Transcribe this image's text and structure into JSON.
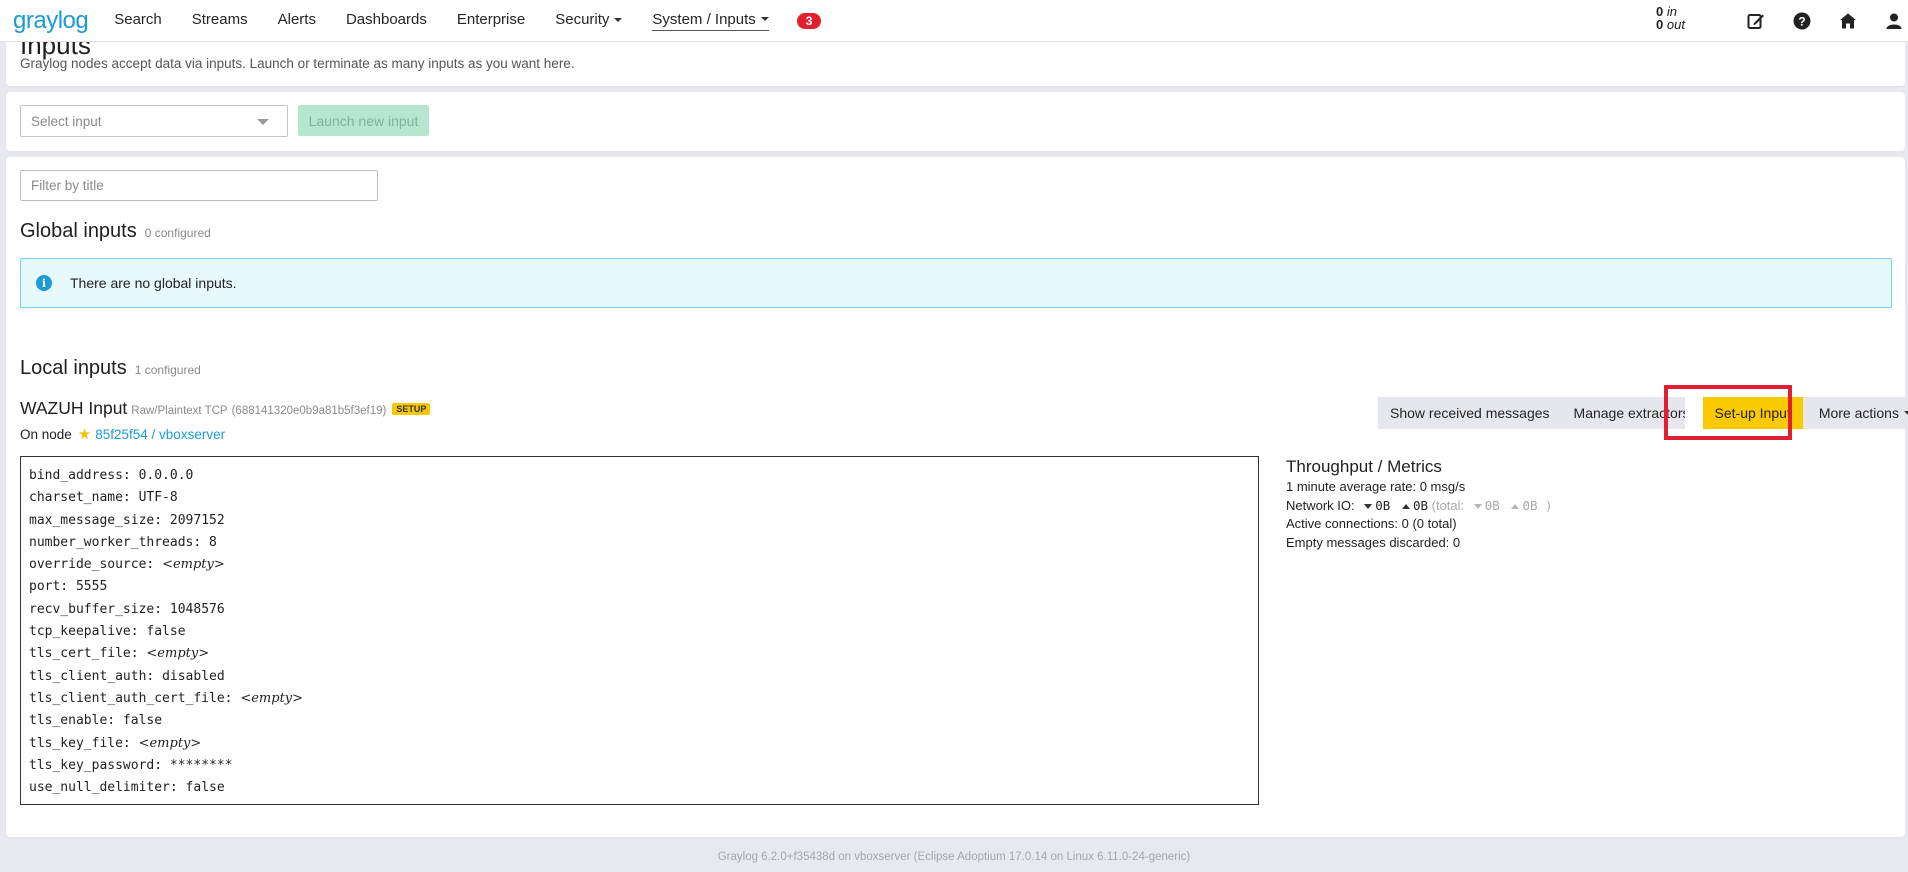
{
  "navbar": {
    "brand": "graylog",
    "items": [
      {
        "label": "Search"
      },
      {
        "label": "Streams"
      },
      {
        "label": "Alerts"
      },
      {
        "label": "Dashboards"
      },
      {
        "label": "Enterprise"
      },
      {
        "label": "Security"
      },
      {
        "label": "System / Inputs"
      }
    ],
    "notification_count": "3",
    "throughput_in_value": "0",
    "throughput_in_label": "in",
    "throughput_out_value": "0",
    "throughput_out_label": "out",
    "icons": [
      "edit-icon",
      "help-icon",
      "home-icon",
      "user-icon"
    ]
  },
  "header": {
    "title": "Inputs",
    "description": "Graylog nodes accept data via inputs. Launch or terminate as many inputs as you want here."
  },
  "launch": {
    "select_placeholder": "Select input",
    "launch_button": "Launch new input"
  },
  "filter": {
    "placeholder": "Filter by title"
  },
  "global_inputs": {
    "title": "Global inputs",
    "count": "0 configured",
    "empty_message": "There are no global inputs."
  },
  "local_inputs": {
    "title": "Local inputs",
    "count": "1 configured"
  },
  "input": {
    "title": "WAZUH Input",
    "type": "Raw/Plaintext TCP",
    "id": "(688141320e0b9a81b5f3ef19)",
    "badge": "SETUP",
    "on_node_label": "On node",
    "node": "85f25f54 / vboxserver",
    "actions": {
      "show_messages": "Show received messages",
      "manage_extractors": "Manage extractors",
      "setup": "Set-up Input",
      "more_actions": "More actions"
    },
    "config": [
      {
        "key": "bind_address: ",
        "value": "0.0.0.0",
        "empty": false
      },
      {
        "key": "charset_name: ",
        "value": "UTF-8",
        "empty": false
      },
      {
        "key": "max_message_size: ",
        "value": "2097152",
        "empty": false
      },
      {
        "key": "number_worker_threads: ",
        "value": "8",
        "empty": false
      },
      {
        "key": "override_source: ",
        "value": "<empty>",
        "empty": true
      },
      {
        "key": "port: ",
        "value": "5555",
        "empty": false
      },
      {
        "key": "recv_buffer_size: ",
        "value": "1048576",
        "empty": false
      },
      {
        "key": "tcp_keepalive: ",
        "value": "false",
        "empty": false
      },
      {
        "key": "tls_cert_file: ",
        "value": "<empty>",
        "empty": true
      },
      {
        "key": "tls_client_auth: ",
        "value": "disabled",
        "empty": false
      },
      {
        "key": "tls_client_auth_cert_file: ",
        "value": "<empty>",
        "empty": true
      },
      {
        "key": "tls_enable: ",
        "value": "false",
        "empty": false
      },
      {
        "key": "tls_key_file: ",
        "value": "<empty>",
        "empty": true
      },
      {
        "key": "tls_key_password: ",
        "value": "********",
        "empty": false
      },
      {
        "key": "use_null_delimiter: ",
        "value": "false",
        "empty": false
      }
    ],
    "metrics": {
      "title": "Throughput / Metrics",
      "avg_rate": "1 minute average rate: 0 msg/s",
      "network_io_label": "Network IO:",
      "net_in": "0B",
      "net_out": "0B",
      "total_label": "(total:",
      "total_in": "0B",
      "total_out": "0B )",
      "active_connections": "Active connections: 0 (0 total)",
      "empty_discarded": "Empty messages discarded: 0"
    }
  },
  "footer": "Graylog 6.2.0+f35438d on vboxserver (Eclipse Adoptium 17.0.14 on Linux 6.11.0-24-generic)"
}
